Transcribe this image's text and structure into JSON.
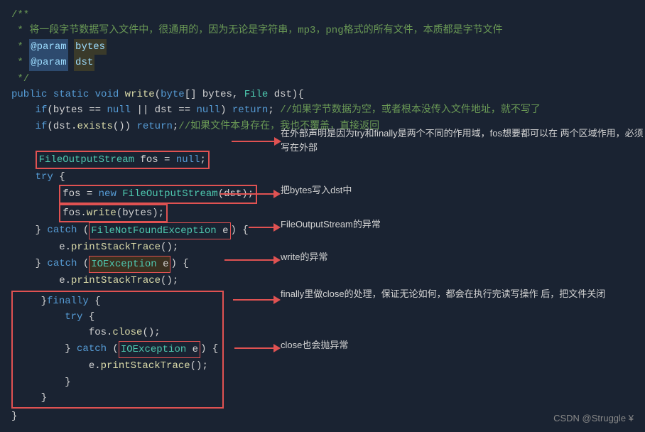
{
  "code": {
    "lines": [
      {
        "id": "l1",
        "content": "/**"
      },
      {
        "id": "l2",
        "content": " * 将一段字节数据写入文件中，很通用的，因为无论是字符串，mp3，png格式的所有文件，本质都是字节文件"
      },
      {
        "id": "l3",
        "content": " * @param bytes"
      },
      {
        "id": "l4",
        "content": " * @param dst"
      },
      {
        "id": "l5",
        "content": " */"
      },
      {
        "id": "l6",
        "content": "public static void write(byte[] bytes, File dst){"
      },
      {
        "id": "l7",
        "content": "    if(bytes == null || dst == null) return; //如果字节数据为空，或者根本没传入文件地址，就不写了"
      },
      {
        "id": "l8",
        "content": "    if(dst.exists()) return;//如果文件本身存在，我也不覆盖，直接返回"
      },
      {
        "id": "l9",
        "content": ""
      },
      {
        "id": "l10",
        "content": "    FileOutputStream fos = null;"
      },
      {
        "id": "l11",
        "content": "    try {"
      },
      {
        "id": "l12",
        "content": "        fos = new FileOutputStream(dst);"
      },
      {
        "id": "l13",
        "content": "        fos.write(bytes);"
      },
      {
        "id": "l14",
        "content": "    } catch (FileNotFoundException e) {"
      },
      {
        "id": "l15",
        "content": "        e.printStackTrace();"
      },
      {
        "id": "l16",
        "content": "    } catch (IOException e) {"
      },
      {
        "id": "l17",
        "content": "        e.printStackTrace();"
      },
      {
        "id": "l18",
        "content": "    }finally {"
      },
      {
        "id": "l19",
        "content": "        try {"
      },
      {
        "id": "l20",
        "content": "            fos.close();"
      },
      {
        "id": "l21",
        "content": "        } catch (IOException e) {"
      },
      {
        "id": "l22",
        "content": "            e.printStackTrace();"
      },
      {
        "id": "l23",
        "content": "        }"
      },
      {
        "id": "l24",
        "content": "    }"
      },
      {
        "id": "l25",
        "content": "}"
      }
    ]
  },
  "annotations": {
    "box1_text": "在外部声明是因为try和finally是两个不同的作用域，fos想要都可以在\n两个区域作用，必须写在外部",
    "arrow1_text": "把bytes写入dst中",
    "arrow2_text": "FileOutputStream的异常",
    "arrow3_text": "write的异常",
    "arrow4_text": "finally里做close的处理，保证无论如何，都会在执行完读写操作\n后，把文件关闭",
    "arrow5_text": "close也会抛异常"
  },
  "watermark": "CSDN @Struggle ¥"
}
